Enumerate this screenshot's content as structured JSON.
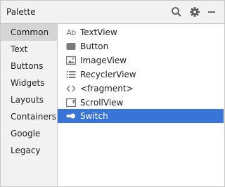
{
  "header": {
    "title": "Palette",
    "icons": [
      "search-icon",
      "gear-icon",
      "minimize-icon"
    ]
  },
  "categories": [
    {
      "label": "Common",
      "selected": true
    },
    {
      "label": "Text"
    },
    {
      "label": "Buttons"
    },
    {
      "label": "Widgets"
    },
    {
      "label": "Layouts"
    },
    {
      "label": "Containers"
    },
    {
      "label": "Google"
    },
    {
      "label": "Legacy"
    }
  ],
  "widgets": [
    {
      "label": "TextView",
      "icon": "textview-icon",
      "icon_text": "Ab"
    },
    {
      "label": "Button",
      "icon": "button-icon"
    },
    {
      "label": "ImageView",
      "icon": "imageview-icon"
    },
    {
      "label": "RecyclerView",
      "icon": "recyclerview-icon"
    },
    {
      "label": "<fragment>",
      "icon": "fragment-icon"
    },
    {
      "label": "ScrollView",
      "icon": "scrollview-icon"
    },
    {
      "label": "Switch",
      "icon": "switch-icon",
      "selected": true
    }
  ],
  "colors": {
    "selection": "#3875d7",
    "category_selected": "#d5d5d5",
    "icon_gray": "#6e6e6e"
  }
}
